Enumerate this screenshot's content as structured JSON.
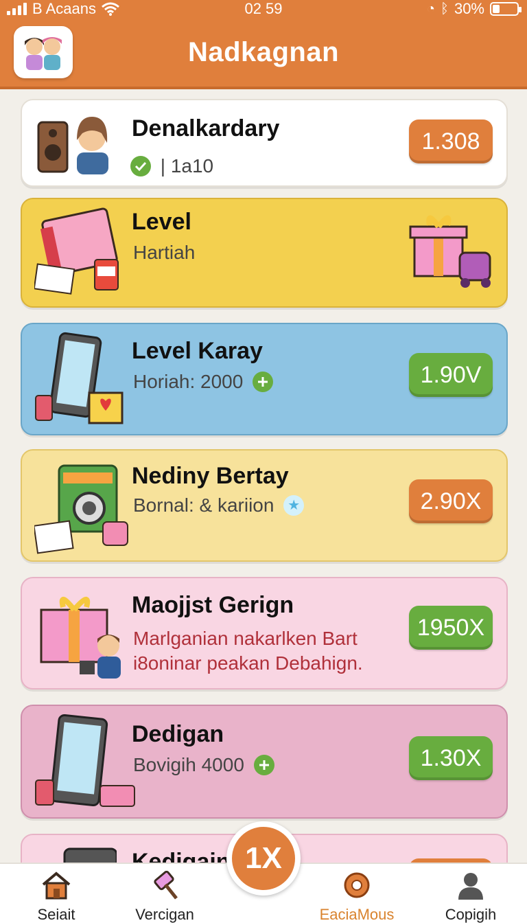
{
  "status": {
    "carrier": "B Acaans",
    "time": "02 59",
    "battery_text": "30%",
    "battery_level": 0.3
  },
  "header": {
    "title": "Nadkagnan",
    "logo_icon": "two-kids-avatar-icon",
    "color": "#e07f3c"
  },
  "cards": [
    {
      "title": "Denalkardary",
      "subtitle": "| 1a10",
      "badge": "1.308",
      "bg": "#ffffff",
      "badge_color": "#e07f3c",
      "icon": "speaker-girl-icon",
      "sub_icon": "check-circle-icon"
    },
    {
      "title": "Level",
      "subtitle": "Hartiah",
      "badge": "",
      "bg": "#f3d04f",
      "badge_color": "",
      "icon": "notebook-icon",
      "right_icon": "gift-box-icon"
    },
    {
      "title": "Level Karay",
      "subtitle": "Horiah: 2000",
      "badge": "1.90V",
      "bg": "#8ec4e3",
      "badge_color": "#68ad3f",
      "icon": "phone-gift-icon",
      "sub_icon": "plus-circle-icon"
    },
    {
      "title": "Nediny Bertay",
      "subtitle": "Bornal: & kariion",
      "badge": "2.90X",
      "bg": "#f7e29b",
      "badge_color": "#e07f3c",
      "icon": "camera-icon",
      "sub_icon": "star-circle-icon"
    },
    {
      "title": "Maojjst Gerign",
      "subtitle": "Marlganian nakarlken Bart",
      "subtitle2": "i8oninar peakan Debahign.",
      "badge": "1950X",
      "bg": "#f9d6e3",
      "badge_color": "#68ad3f",
      "icon": "gift-boy-icon"
    },
    {
      "title": "Dedigan",
      "subtitle": "Bovigih 4000",
      "badge": "1.30X",
      "bg": "#e9b3ca",
      "badge_color": "#68ad3f",
      "icon": "phone-icon",
      "sub_icon": "plus-circle-icon"
    },
    {
      "title": "Kedigain",
      "subtitle": "",
      "badge": "",
      "bg": "#f9d6e3",
      "badge_color": "#e07f3c",
      "icon": "tablet-icon"
    }
  ],
  "fab": {
    "label": "1X",
    "icon": "multiplier-icon"
  },
  "nav": [
    {
      "label": "Seiait",
      "icon": "home-icon"
    },
    {
      "label": "Vercigan",
      "icon": "hammer-icon"
    },
    {
      "label": "EaciaMous",
      "icon": "donut-icon",
      "active": true
    },
    {
      "label": "Copigih",
      "icon": "profile-icon"
    }
  ]
}
